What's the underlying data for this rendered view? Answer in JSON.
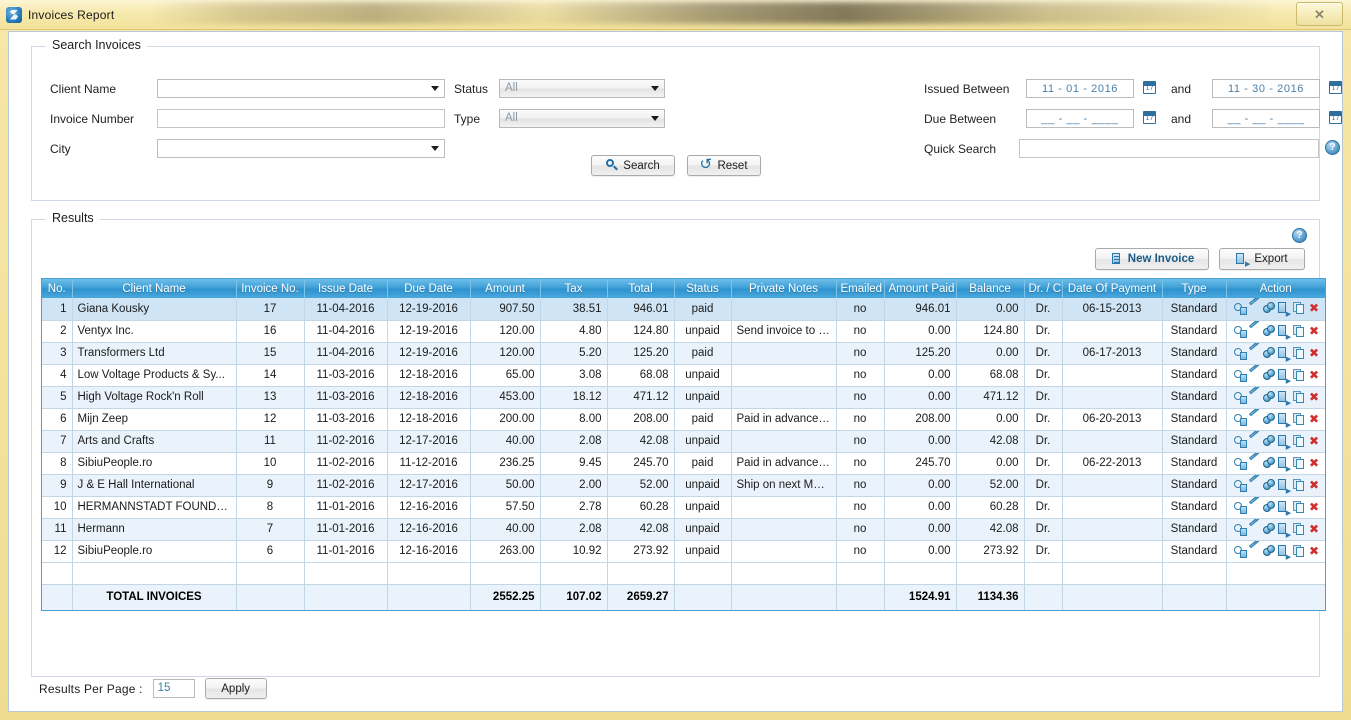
{
  "window": {
    "title": "Invoices Report",
    "app_icon": "app-icon",
    "close_label": "✕"
  },
  "search_panel": {
    "title": "Search Invoices",
    "fields": {
      "client_name_label": "Client Name",
      "client_name_value": "",
      "invoice_number_label": "Invoice Number",
      "invoice_number_value": "",
      "city_label": "City",
      "city_value": "",
      "status_label": "Status",
      "status_value": "All",
      "type_label": "Type",
      "type_value": "All",
      "issued_between_label": "Issued Between",
      "issued_from": "11 - 01 - 2016",
      "issued_to": "11 - 30 - 2016",
      "due_between_label": "Due Between",
      "due_from": "__ - __ - ____",
      "due_to": "__ - __ - ____",
      "and_label": "and",
      "quick_search_label": "Quick Search",
      "quick_search_value": "",
      "help_glyph": "?"
    },
    "buttons": {
      "search": "Search",
      "reset": "Reset"
    }
  },
  "results_panel": {
    "title": "Results",
    "help_glyph": "?",
    "buttons": {
      "new_invoice": "New Invoice",
      "export": "Export"
    },
    "columns": [
      "No.",
      "Client Name",
      "Invoice No.",
      "Issue Date",
      "Due Date",
      "Amount",
      "Tax",
      "Total",
      "Status",
      "Private Notes",
      "Emailed",
      "Amount Paid",
      "Balance",
      "Dr. / Cr.",
      "Date Of Payment",
      "Type",
      "Action"
    ],
    "rows": [
      {
        "no": "1",
        "client": "Giana Kousky",
        "invoice_no": "17",
        "issue_date": "11-04-2016",
        "due_date": "12-19-2016",
        "amount": "907.50",
        "tax": "38.51",
        "total": "946.01",
        "status": "paid",
        "notes": "",
        "emailed": "no",
        "amount_paid": "946.01",
        "balance": "0.00",
        "drcr": "Dr.",
        "date_of_payment": "06-15-2013",
        "type": "Standard"
      },
      {
        "no": "2",
        "client": "Ventyx Inc.",
        "invoice_no": "16",
        "issue_date": "11-04-2016",
        "due_date": "12-19-2016",
        "amount": "120.00",
        "tax": "4.80",
        "total": "124.80",
        "status": "unpaid",
        "notes": "Send invoice to Mr Vent personally!",
        "emailed": "no",
        "amount_paid": "0.00",
        "balance": "124.80",
        "drcr": "Dr.",
        "date_of_payment": "",
        "type": "Standard"
      },
      {
        "no": "3",
        "client": "Transformers Ltd",
        "invoice_no": "15",
        "issue_date": "11-04-2016",
        "due_date": "12-19-2016",
        "amount": "120.00",
        "tax": "5.20",
        "total": "125.20",
        "status": "paid",
        "notes": "",
        "emailed": "no",
        "amount_paid": "125.20",
        "balance": "0.00",
        "drcr": "Dr.",
        "date_of_payment": "06-17-2013",
        "type": "Standard"
      },
      {
        "no": "4",
        "client": "Low Voltage Products & Sy...",
        "invoice_no": "14",
        "issue_date": "11-03-2016",
        "due_date": "12-18-2016",
        "amount": "65.00",
        "tax": "3.08",
        "total": "68.08",
        "status": "unpaid",
        "notes": "",
        "emailed": "no",
        "amount_paid": "0.00",
        "balance": "68.08",
        "drcr": "Dr.",
        "date_of_payment": "",
        "type": "Standard"
      },
      {
        "no": "5",
        "client": "High Voltage Rock'n Roll",
        "invoice_no": "13",
        "issue_date": "11-03-2016",
        "due_date": "12-18-2016",
        "amount": "453.00",
        "tax": "18.12",
        "total": "471.12",
        "status": "unpaid",
        "notes": "",
        "emailed": "no",
        "amount_paid": "0.00",
        "balance": "471.12",
        "drcr": "Dr.",
        "date_of_payment": "",
        "type": "Standard"
      },
      {
        "no": "6",
        "client": "Mijn Zeep",
        "invoice_no": "12",
        "issue_date": "11-03-2016",
        "due_date": "12-18-2016",
        "amount": "200.00",
        "tax": "8.00",
        "total": "208.00",
        "status": "paid",
        "notes": "Paid in advance via Bank",
        "emailed": "no",
        "amount_paid": "208.00",
        "balance": "0.00",
        "drcr": "Dr.",
        "date_of_payment": "06-20-2013",
        "type": "Standard"
      },
      {
        "no": "7",
        "client": "Arts and Crafts",
        "invoice_no": "11",
        "issue_date": "11-02-2016",
        "due_date": "12-17-2016",
        "amount": "40.00",
        "tax": "2.08",
        "total": "42.08",
        "status": "unpaid",
        "notes": "",
        "emailed": "no",
        "amount_paid": "0.00",
        "balance": "42.08",
        "drcr": "Dr.",
        "date_of_payment": "",
        "type": "Standard"
      },
      {
        "no": "8",
        "client": "SibiuPeople.ro",
        "invoice_no": "10",
        "issue_date": "11-02-2016",
        "due_date": "11-12-2016",
        "amount": "236.25",
        "tax": "9.45",
        "total": "245.70",
        "status": "paid",
        "notes": "Paid in advance via bank",
        "emailed": "no",
        "amount_paid": "245.70",
        "balance": "0.00",
        "drcr": "Dr.",
        "date_of_payment": "06-22-2013",
        "type": "Standard"
      },
      {
        "no": "9",
        "client": "J & E Hall International",
        "invoice_no": "9",
        "issue_date": "11-02-2016",
        "due_date": "12-17-2016",
        "amount": "50.00",
        "tax": "2.00",
        "total": "52.00",
        "status": "unpaid",
        "notes": "Ship on next Monday!",
        "emailed": "no",
        "amount_paid": "0.00",
        "balance": "52.00",
        "drcr": "Dr.",
        "date_of_payment": "",
        "type": "Standard"
      },
      {
        "no": "10",
        "client": "HERMANNSTADT FOUNDAT...",
        "invoice_no": "8",
        "issue_date": "11-01-2016",
        "due_date": "12-16-2016",
        "amount": "57.50",
        "tax": "2.78",
        "total": "60.28",
        "status": "unpaid",
        "notes": "",
        "emailed": "no",
        "amount_paid": "0.00",
        "balance": "60.28",
        "drcr": "Dr.",
        "date_of_payment": "",
        "type": "Standard"
      },
      {
        "no": "11",
        "client": "Hermann",
        "invoice_no": "7",
        "issue_date": "11-01-2016",
        "due_date": "12-16-2016",
        "amount": "40.00",
        "tax": "2.08",
        "total": "42.08",
        "status": "unpaid",
        "notes": "",
        "emailed": "no",
        "amount_paid": "0.00",
        "balance": "42.08",
        "drcr": "Dr.",
        "date_of_payment": "",
        "type": "Standard"
      },
      {
        "no": "12",
        "client": "SibiuPeople.ro",
        "invoice_no": "6",
        "issue_date": "11-01-2016",
        "due_date": "12-16-2016",
        "amount": "263.00",
        "tax": "10.92",
        "total": "273.92",
        "status": "unpaid",
        "notes": "",
        "emailed": "no",
        "amount_paid": "0.00",
        "balance": "273.92",
        "drcr": "Dr.",
        "date_of_payment": "",
        "type": "Standard"
      }
    ],
    "totals": {
      "label": "TOTAL INVOICES",
      "amount": "2552.25",
      "tax": "107.02",
      "total": "2659.27",
      "amount_paid": "1524.91",
      "balance": "1134.36"
    },
    "action_icons": [
      "view-invoice-icon",
      "edit-invoice-icon",
      "record-payment-icon",
      "send-invoice-icon",
      "duplicate-invoice-icon",
      "delete-invoice-icon"
    ],
    "delete_glyph": "✖"
  },
  "footer": {
    "results_per_page_label": "Results Per Page :",
    "results_per_page_value": "15",
    "apply_label": "Apply"
  },
  "colors": {
    "header_blue": "#3f9fd6",
    "paid_green": "#2e9e4f",
    "emailed_red": "#b14a4a",
    "delete_red": "#d12f2f",
    "chrome_yellow": "#f4e39f"
  }
}
